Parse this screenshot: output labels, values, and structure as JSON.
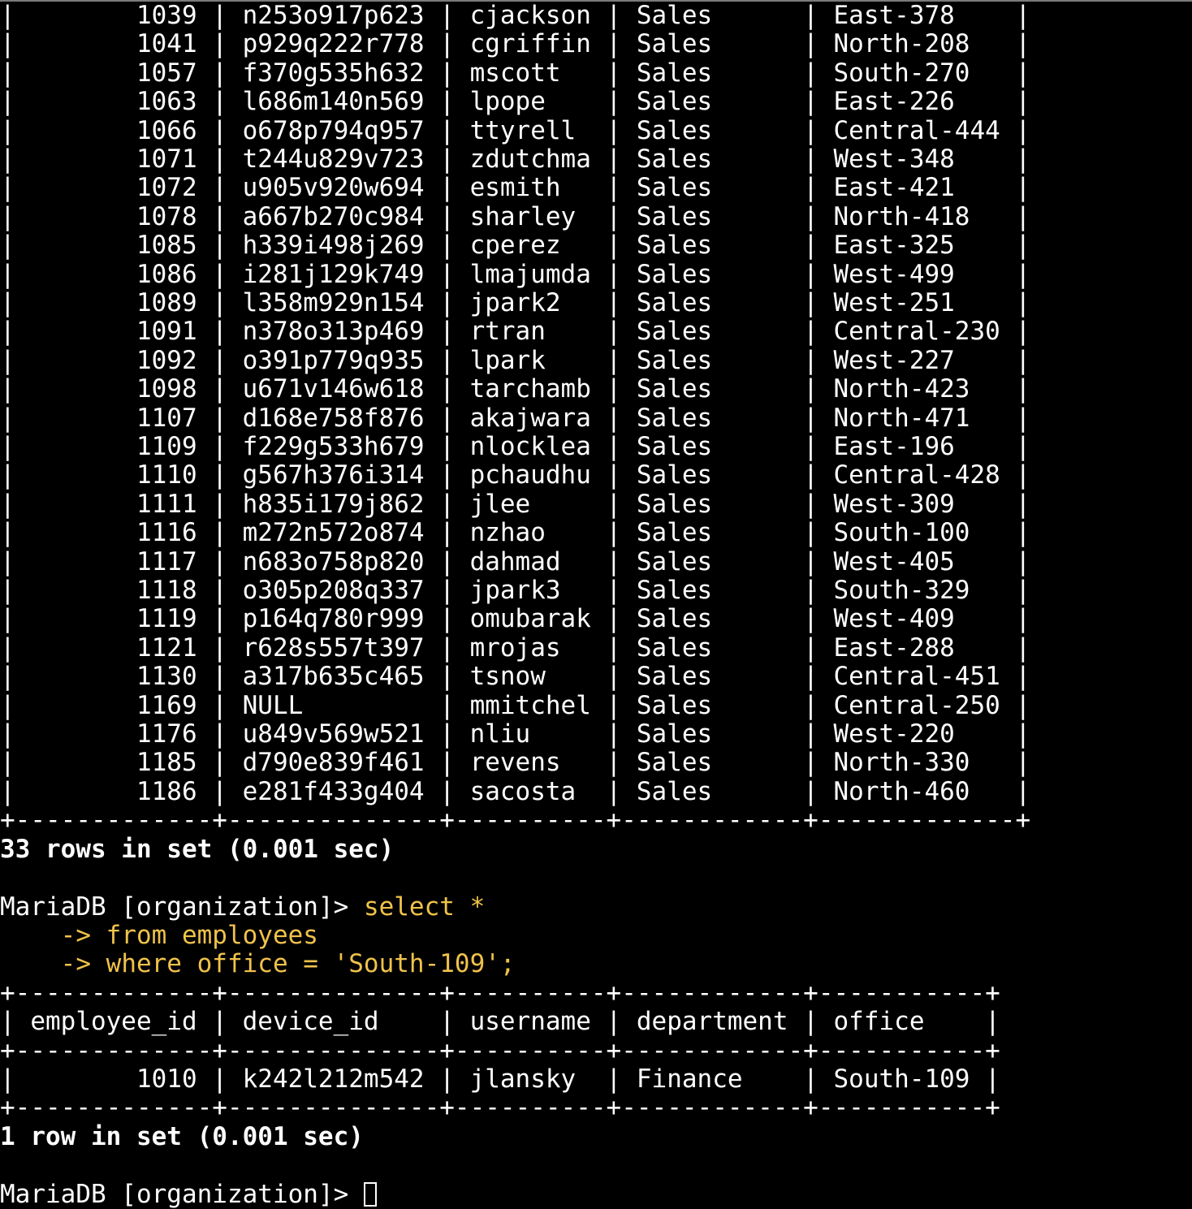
{
  "terminal": {
    "table1_rows": [
      "|        1039 | n253o917p623 | cjackson | Sales      | East-378    |",
      "|        1041 | p929q222r778 | cgriffin | Sales      | North-208   |",
      "|        1057 | f370g535h632 | mscott   | Sales      | South-270   |",
      "|        1063 | l686m140n569 | lpope    | Sales      | East-226    |",
      "|        1066 | o678p794q957 | ttyrell  | Sales      | Central-444 |",
      "|        1071 | t244u829v723 | zdutchma | Sales      | West-348    |",
      "|        1072 | u905v920w694 | esmith   | Sales      | East-421    |",
      "|        1078 | a667b270c984 | sharley  | Sales      | North-418   |",
      "|        1085 | h339i498j269 | cperez   | Sales      | East-325    |",
      "|        1086 | i281j129k749 | lmajumda | Sales      | West-499    |",
      "|        1089 | l358m929n154 | jpark2   | Sales      | West-251    |",
      "|        1091 | n378o313p469 | rtran    | Sales      | Central-230 |",
      "|        1092 | o391p779q935 | lpark    | Sales      | West-227    |",
      "|        1098 | u671v146w618 | tarchamb | Sales      | North-423   |",
      "|        1107 | d168e758f876 | akajwara | Sales      | North-471   |",
      "|        1109 | f229g533h679 | nlocklea | Sales      | East-196    |",
      "|        1110 | g567h376i314 | pchaudhu | Sales      | Central-428 |",
      "|        1111 | h835i179j862 | jlee     | Sales      | West-309    |",
      "|        1116 | m272n572o874 | nzhao    | Sales      | South-100   |",
      "|        1117 | n683o758p820 | dahmad   | Sales      | West-405    |",
      "|        1118 | o305p208q337 | jpark3   | Sales      | South-329   |",
      "|        1119 | p164q780r999 | omubarak | Sales      | West-409    |",
      "|        1121 | r628s557t397 | mrojas   | Sales      | East-288    |",
      "|        1130 | a317b635c465 | tsnow    | Sales      | Central-451 |",
      "|        1169 | NULL         | mmitchel | Sales      | Central-250 |",
      "|        1176 | u849v569w521 | nliu     | Sales      | West-220    |",
      "|        1185 | d790e839f461 | revens   | Sales      | North-330   |",
      "|        1186 | e281f433g404 | sacosta  | Sales      | North-460   |"
    ],
    "table1_border": "+-------------+--------------+----------+------------+-------------+",
    "table1_footer": "33 rows in set (0.001 sec)",
    "prompt": "MariaDB [organization]> ",
    "query_line1": "select *",
    "query_cont_arrow": "    -> ",
    "query_line2": "from employees",
    "query_line3": "where office = 'South-109';",
    "table2_border": "+-------------+--------------+----------+------------+-----------+",
    "table2_header": "| employee_id | device_id    | username | department | office    |",
    "table2_row": "|        1010 | k242l212m542 | jlansky  | Finance    | South-109 |",
    "table2_footer": "1 row in set (0.001 sec)",
    "final_prompt": "MariaDB [organization]> "
  },
  "colors": {
    "background": "#000000",
    "text": "#ffffff",
    "query": "#f0c24b"
  }
}
